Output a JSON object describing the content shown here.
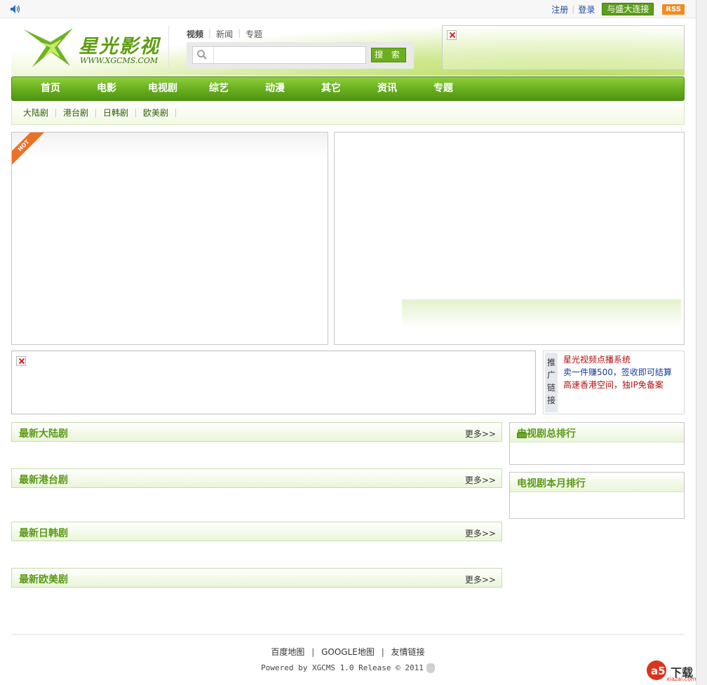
{
  "topbar": {
    "links": [
      "注册",
      "登录"
    ],
    "sheng_button": "与盛大连接",
    "rss_label": "RSS"
  },
  "header": {
    "logo_title": "星光影视",
    "logo_url": "WWW.XGCMS.COM",
    "search_tabs": [
      "视频",
      "新闻",
      "专题"
    ],
    "search_placeholder": "",
    "search_button": "搜 索"
  },
  "nav": {
    "items": [
      "首页",
      "电影",
      "电视剧",
      "综艺",
      "动漫",
      "其它",
      "资讯",
      "专题"
    ]
  },
  "subnav": {
    "items": [
      "大陆剧",
      "港台剧",
      "日韩剧",
      "欧美剧"
    ]
  },
  "showcase": {
    "hot_badge": "HOT"
  },
  "promo": {
    "label": "推广链接",
    "links": [
      {
        "text": "星光视频点播系统",
        "color": "#b10d0d"
      },
      {
        "text": "卖一件赚500，签收即可结算",
        "color": "#1a3a9a"
      },
      {
        "text": "高速香港空间，独IP免备案",
        "color": "#b10d0d"
      }
    ]
  },
  "sections": [
    {
      "title": "最新大陆剧",
      "more": "更多>>"
    },
    {
      "title": "最新港台剧",
      "more": "更多>>"
    },
    {
      "title": "最新日韩剧",
      "more": "更多>>"
    },
    {
      "title": "最新欧美剧",
      "more": "更多>>"
    }
  ],
  "sidebar": {
    "boxes": [
      {
        "title": "电视剧总排行"
      },
      {
        "title": "电视剧本月排行"
      }
    ]
  },
  "footer": {
    "links": [
      "百度地图",
      "GOOGLE地图",
      "友情链接"
    ],
    "powered": "Powered by XGCMS 1.0 Release © 2011"
  },
  "watermark": {
    "text": "下载",
    "sub": "xiazai.com"
  },
  "colors": {
    "accent_green": "#6db322",
    "title_green": "#5a9a16",
    "link_blue": "#1a4aa8",
    "hot_orange": "#ef6f23"
  }
}
